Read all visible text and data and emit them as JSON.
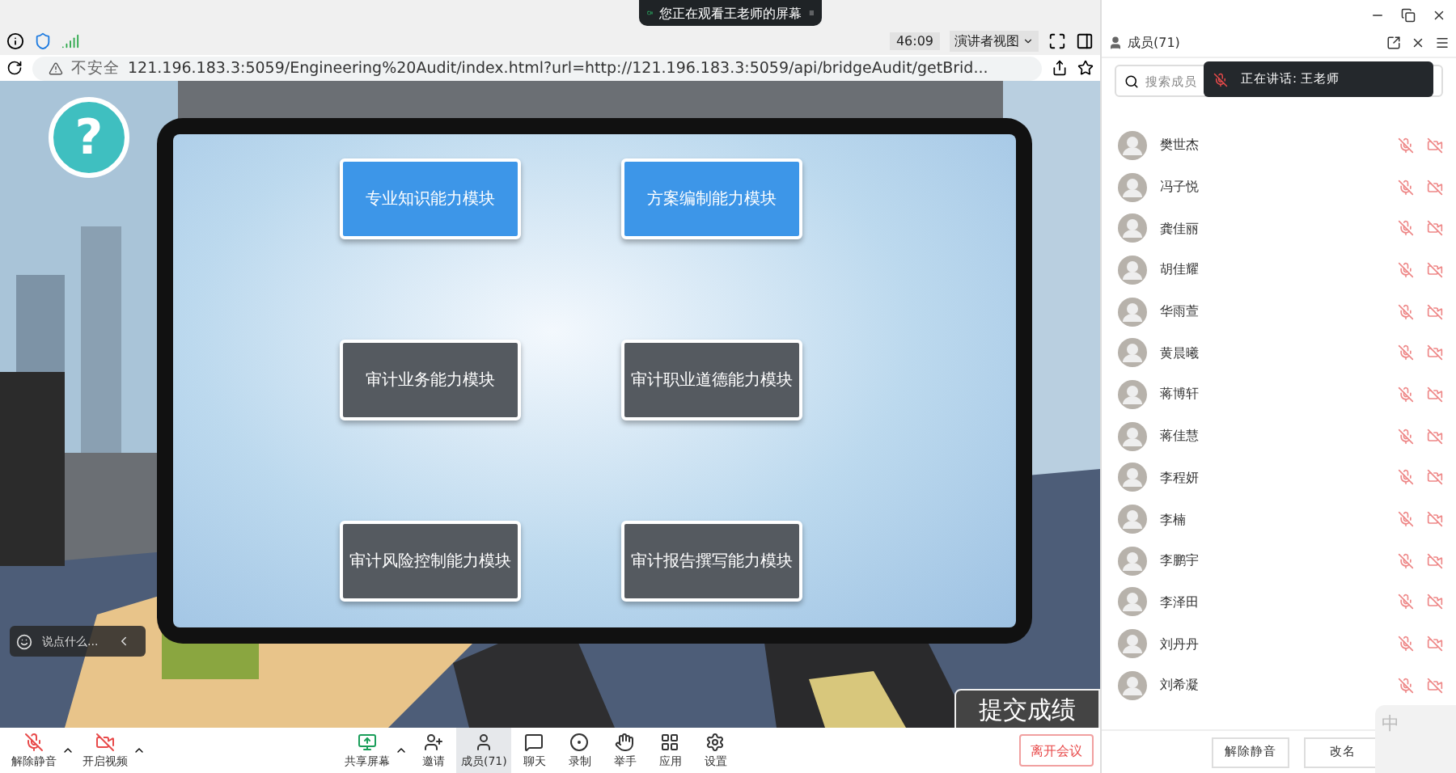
{
  "share_notice": "您正在观看王老师的屏幕",
  "meeting_bar": {
    "timer": "46:09",
    "view_mode": "演讲者视图"
  },
  "browser": {
    "security": "不安全",
    "url": "121.196.183.3:5059/Engineering%20Audit/index.html?url=http://121.196.183.3:5059/api/bridgeAudit/getBrid..."
  },
  "app": {
    "help": "?",
    "submit": "提交成绩",
    "modules": [
      {
        "label": "专业知识能力模块",
        "highlighted": true
      },
      {
        "label": "方案编制能力模块",
        "highlighted": true
      },
      {
        "label": "审计业务能力模块",
        "highlighted": false
      },
      {
        "label": "审计职业道德能力模块",
        "highlighted": false
      },
      {
        "label": "审计风险控制能力模块",
        "highlighted": false
      },
      {
        "label": "审计报告撰写能力模块",
        "highlighted": false
      }
    ]
  },
  "chat_input": {
    "placeholder": "说点什么..."
  },
  "toolbar": [
    {
      "kind": "mic",
      "label": "解除静音",
      "selected": false,
      "menu": true
    },
    {
      "kind": "video",
      "label": "开启视频",
      "selected": false,
      "menu": true
    },
    {
      "kind": "share",
      "label": "共享屏幕",
      "selected": false,
      "menu": true
    },
    {
      "kind": "invite",
      "label": "邀请",
      "selected": false,
      "menu": false
    },
    {
      "kind": "members",
      "label": "成员(71)",
      "selected": true,
      "menu": false
    },
    {
      "kind": "chat",
      "label": "聊天",
      "selected": false,
      "menu": false
    },
    {
      "kind": "record",
      "label": "录制",
      "selected": false,
      "menu": false
    },
    {
      "kind": "hand",
      "label": "举手",
      "selected": false,
      "menu": false
    },
    {
      "kind": "apps",
      "label": "应用",
      "selected": false,
      "menu": false
    },
    {
      "kind": "settings",
      "label": "设置",
      "selected": false,
      "menu": false
    }
  ],
  "leave_button": "离开会议",
  "members_panel": {
    "title": "成员(71)",
    "search_placeholder": "搜索成员",
    "speaking": "正在讲话: 王老师",
    "members": [
      {
        "name": "樊世杰",
        "muted": true,
        "video_off": true
      },
      {
        "name": "冯子悦",
        "muted": true,
        "video_off": true
      },
      {
        "name": "龚佳丽",
        "muted": true,
        "video_off": true
      },
      {
        "name": "胡佳耀",
        "muted": true,
        "video_off": true
      },
      {
        "name": "华雨萱",
        "muted": true,
        "video_off": true
      },
      {
        "name": "黄晨曦",
        "muted": true,
        "video_off": true
      },
      {
        "name": "蒋博轩",
        "muted": true,
        "video_off": true
      },
      {
        "name": "蒋佳慧",
        "muted": true,
        "video_off": true
      },
      {
        "name": "李程妍",
        "muted": true,
        "video_off": true
      },
      {
        "name": "李楠",
        "muted": true,
        "video_off": true
      },
      {
        "name": "李鹏宇",
        "muted": true,
        "video_off": true
      },
      {
        "name": "李泽田",
        "muted": true,
        "video_off": true
      },
      {
        "name": "刘丹丹",
        "muted": true,
        "video_off": true
      },
      {
        "name": "刘希凝",
        "muted": true,
        "video_off": true
      }
    ],
    "buttons": [
      "解除静音",
      "改名"
    ]
  },
  "ime": {
    "mode": "中"
  }
}
